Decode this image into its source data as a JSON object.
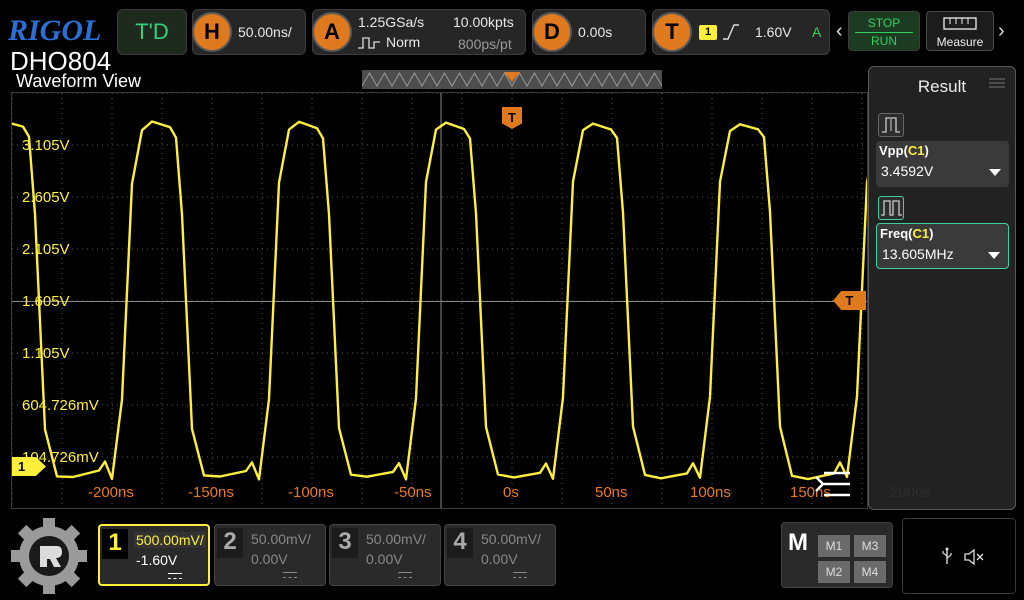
{
  "header": {
    "brand": "RIGOL",
    "model": "DHO804",
    "td_label": "T'D",
    "horizontal": {
      "badge": "H",
      "timebase": "50.00ns/"
    },
    "acquire": {
      "badge": "A",
      "sample_rate": "1.25GSa/s",
      "mode": "Norm",
      "memory_depth": "10.00kpts",
      "points": "800ps/pt"
    },
    "delay": {
      "badge": "D",
      "value": "0.00s"
    },
    "trigger": {
      "badge": "T",
      "source": "1",
      "level": "1.60V",
      "status": "A"
    },
    "stop_label": "STOP",
    "run_label": "RUN",
    "measure_label": "Measure"
  },
  "waveform_view": {
    "title": "Waveform View",
    "y_labels": [
      "3.105V",
      "2.605V",
      "2.105V",
      "1.605V",
      "1.105V",
      "604.726mV",
      "104.726mV"
    ],
    "x_labels": [
      "-200ns",
      "-150ns",
      "-100ns",
      "-50ns",
      "0s",
      "50ns",
      "100ns",
      "150ns",
      "200ns"
    ],
    "trigger_marker": "T",
    "trigger_level_marker": "T",
    "ch1_marker": "1"
  },
  "result_panel": {
    "title": "Result",
    "measurements": [
      {
        "name": "Vpp",
        "source": "C1",
        "value": "3.4592V"
      },
      {
        "name": "Freq",
        "source": "C1",
        "value": "13.605MHz"
      }
    ]
  },
  "channels": [
    {
      "num": "1",
      "scale": "500.00mV/",
      "offset": "-1.60V",
      "enabled": true
    },
    {
      "num": "2",
      "scale": "50.00mV/",
      "offset": "0.00V",
      "enabled": false
    },
    {
      "num": "3",
      "scale": "50.00mV/",
      "offset": "0.00V",
      "enabled": false
    },
    {
      "num": "4",
      "scale": "50.00mV/",
      "offset": "0.00V",
      "enabled": false
    }
  ],
  "math": {
    "label": "M",
    "buttons": [
      "M1",
      "M3",
      "M2",
      "M4"
    ]
  },
  "colors": {
    "ch1": "#ffef3a",
    "accent_orange": "#e07a1f",
    "run_green": "#35d060",
    "grid": "#555555"
  }
}
